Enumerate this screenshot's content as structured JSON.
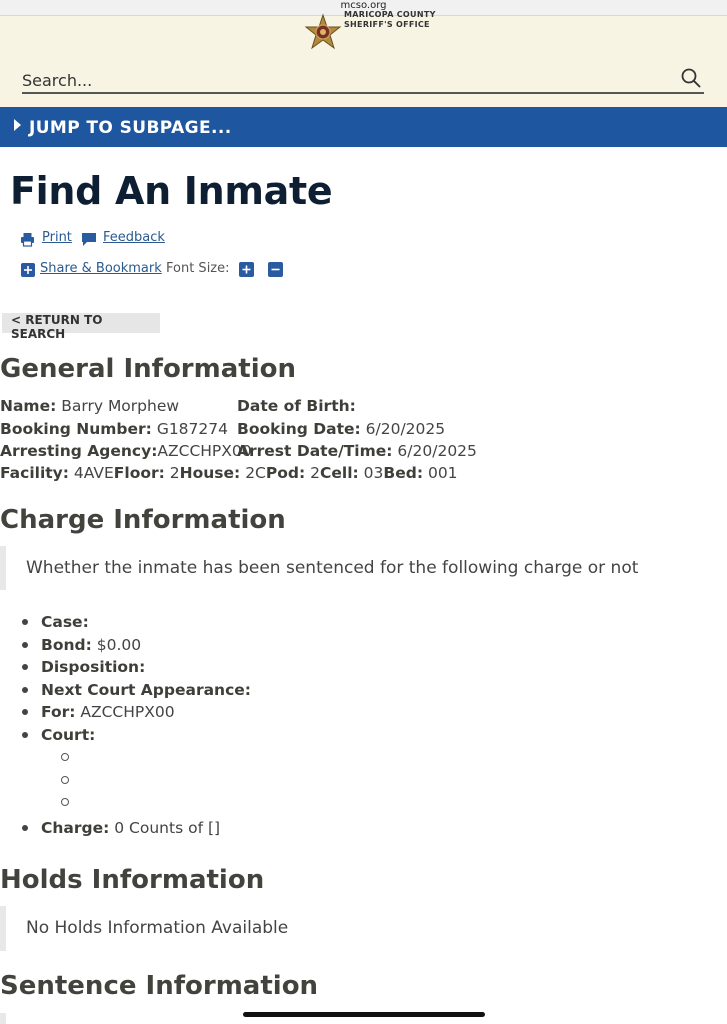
{
  "browser": {
    "url": "mcso.org"
  },
  "header": {
    "logo_text_line1": "MARICOPA COUNTY",
    "logo_text_line2": "SHERIFF'S OFFICE",
    "search_placeholder": "Search..."
  },
  "jump": {
    "label": "JUMP TO SUBPAGE..."
  },
  "page": {
    "title": "Find An Inmate",
    "print_label": "Print",
    "feedback_label": "Feedback",
    "share_label": "Share & Bookmark",
    "font_size_label": "Font Size:",
    "return_label": "< RETURN TO SEARCH"
  },
  "general": {
    "heading": "General Information",
    "name_label": "Name:",
    "name_value": "Barry Morphew",
    "dob_label": "Date of Birth:",
    "dob_value": "",
    "booking_number_label": "Booking Number:",
    "booking_number_value": "G187274",
    "booking_date_label": "Booking Date:",
    "booking_date_value": "6/20/2025",
    "agency_label": "Arresting Agency:",
    "agency_value": "AZCCHPX00",
    "arrest_label": "Arrest Date/Time:",
    "arrest_value": "6/20/2025",
    "facility_label": "Facility:",
    "facility_value": "4AVE",
    "floor_label": "Floor:",
    "floor_value": "2",
    "house_label": "House:",
    "house_value": "2C",
    "pod_label": "Pod:",
    "pod_value": "2",
    "cell_label": "Cell:",
    "cell_value": "03",
    "bed_label": "Bed:",
    "bed_value": "001"
  },
  "charge": {
    "heading": "Charge Information",
    "note": "Whether the inmate has been sentenced for the following charge or not",
    "case_label": "Case:",
    "case_value": "",
    "bond_label": "Bond:",
    "bond_value": "$0.00",
    "disposition_label": "Disposition:",
    "next_court_label": "Next Court Appearance:",
    "for_label": "For:",
    "for_value": "AZCCHPX00",
    "court_label": "Court:",
    "charge_label": "Charge:",
    "charge_value": "0 Counts of []"
  },
  "holds": {
    "heading": "Holds Information",
    "note": "No Holds Information Available"
  },
  "sentence": {
    "heading": "Sentence Information"
  },
  "colors": {
    "header_bg": "#f8f4e4",
    "jump_bg": "#1e57a0",
    "link": "#2a5a8f",
    "icon_blue": "#2a5aa0"
  }
}
